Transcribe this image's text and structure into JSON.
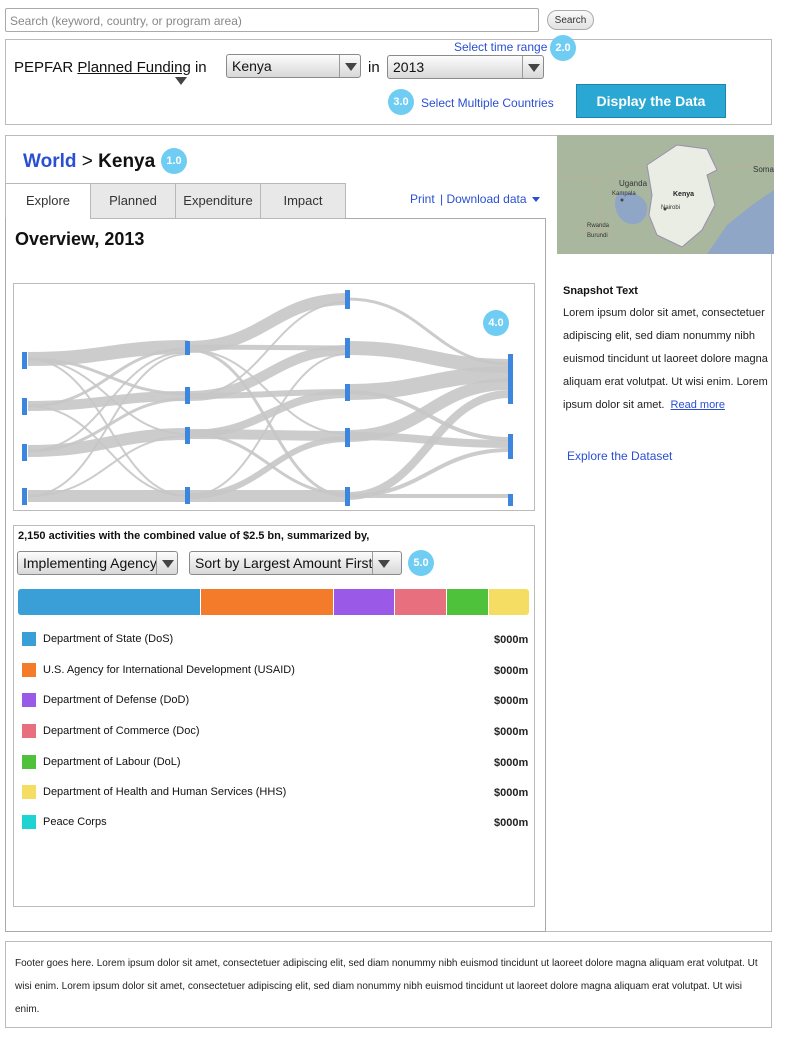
{
  "search": {
    "placeholder": "Search (keyword, country, or program area)",
    "button": "Search"
  },
  "selector": {
    "prefix": "PEPFAR",
    "funding_type": "Planned Funding",
    "in1": "in",
    "in2": "in",
    "country": "Kenya",
    "year": "2013",
    "time_range_link": "Select time range",
    "multi_country_link": "Select Multiple Countries",
    "display_button": "Display the Data"
  },
  "bubbles": {
    "b1": "1.0",
    "b2": "2.0",
    "b3": "3.0",
    "b4": "4.0",
    "b5": "5.0"
  },
  "breadcrumb": {
    "world": "World",
    "sep": ">",
    "country": "Kenya"
  },
  "tabs": [
    {
      "label": "Explore"
    },
    {
      "label": "Planned"
    },
    {
      "label": "Expenditure"
    },
    {
      "label": "Impact"
    }
  ],
  "actions": {
    "print": "Print",
    "download": "| Download data"
  },
  "overview_title": "Overview, 2013",
  "map": {
    "label_country": "Kenya",
    "label_uganda": "Uganda",
    "label_somalia": "Somali",
    "label_kampala": "Kampala",
    "label_nairobi": "Nairobi",
    "label_rwanda": "Rwanda",
    "label_burundi": "Burundi"
  },
  "snapshot": {
    "title": "Snapshot Text",
    "lines": [
      "Lorem ipsum dolor sit amet, consectetuer",
      "adipiscing elit, sed diam nonummy nibh",
      "euismod tincidunt ut laoreet dolore magna",
      "aliquam erat volutpat. Ut wisi enim. Lorem",
      "ipsum dolor sit amet."
    ],
    "read_more": "Read more",
    "explore_link": "Explore the Dataset"
  },
  "summary": {
    "text": "2,150 activities with the combined value of $2.5 bn, summarized by,",
    "group_by": "Implementing Agency",
    "sort_by": "Sort by Largest Amount First"
  },
  "agencies": [
    {
      "name": "Department of State (DoS)",
      "amount": "$000m",
      "color": "#3a9fd6",
      "share": 36
    },
    {
      "name": "U.S. Agency for International Development (USAID)",
      "amount": "$000m",
      "color": "#f47b29",
      "share": 26
    },
    {
      "name": "Department of Defense (DoD)",
      "amount": "$000m",
      "color": "#9b59e8",
      "share": 12
    },
    {
      "name": "Department of Commerce (Doc)",
      "amount": "$000m",
      "color": "#e8707e",
      "share": 10
    },
    {
      "name": "Department of Labour (DoL)",
      "amount": "$000m",
      "color": "#4ec23b",
      "share": 8
    },
    {
      "name": "Department of Health and Human Services (HHS)",
      "amount": "$000m",
      "color": "#f5dc62",
      "share": 8
    },
    {
      "name": "Peace Corps",
      "amount": "$000m",
      "color": "#1fd3d3",
      "share": 0
    }
  ],
  "footer": "Footer goes here. Lorem ipsum dolor sit amet, consectetuer adipiscing elit, sed diam nonummy nibh euismod tincidunt ut laoreet dolore magna aliquam erat volutpat. Ut wisi enim. Lorem ipsum dolor sit amet, consectetuer adipiscing elit, sed diam nonummy nibh euismod tincidunt ut laoreet dolore magna aliquam erat volutpat. Ut wisi enim."
}
